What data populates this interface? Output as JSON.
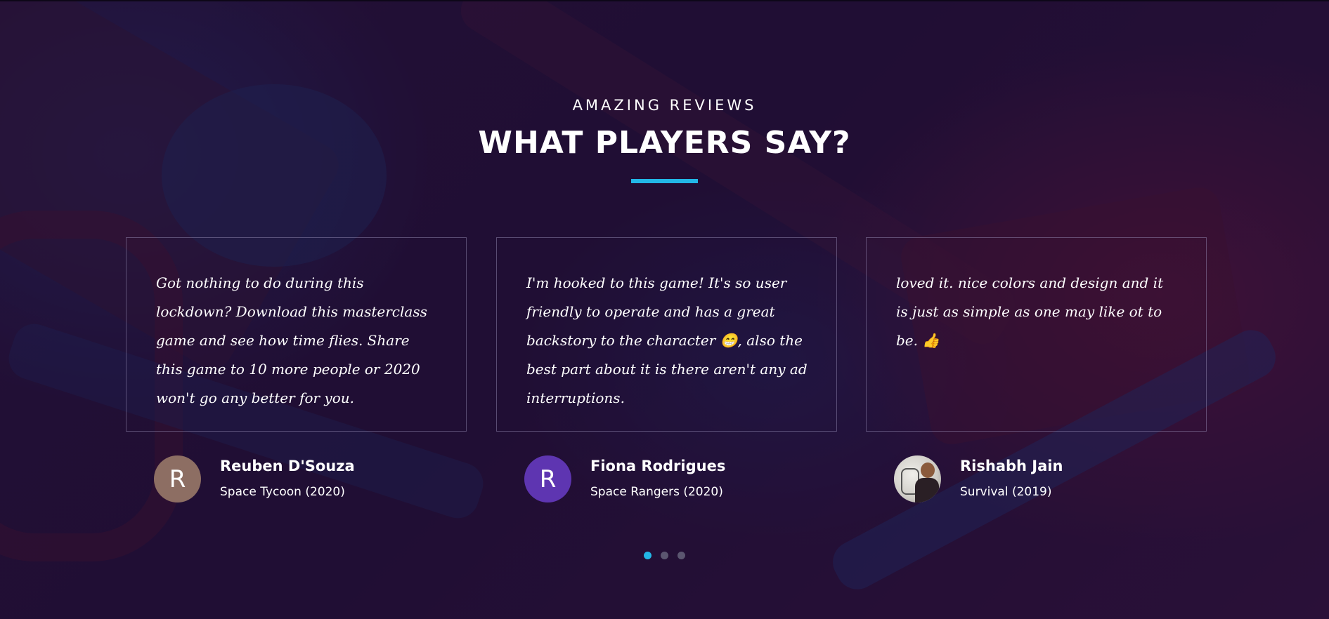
{
  "section": {
    "eyebrow": "AMAZING REVIEWS",
    "title": "WHAT PLAYERS SAY?",
    "accent_color": "#22b7e6"
  },
  "reviews": [
    {
      "quote": "Got nothing to do during this lockdown? Download this masterclass game and see how time flies. Share this game to 10 more people or 2020 won't go any better for you.",
      "name": "Reuben D'Souza",
      "game": "Space Tycoon (2020)",
      "avatar_letter": "R",
      "avatar_color": "#8d6e63"
    },
    {
      "quote": "I'm hooked to this game! It's so user friendly to operate and has a great backstory to the character 😁, also the best part about it is there aren't any ad interruptions.",
      "name": "Fiona Rodrigues",
      "game": "Space Rangers (2020)",
      "avatar_letter": "R",
      "avatar_color": "#5e35b1"
    },
    {
      "quote": "loved it. nice colors and design and it is just as simple as one may like ot to be. 👍",
      "name": "Rishabh Jain",
      "game": "Survival (2019)",
      "avatar_icon": "user-photo"
    }
  ],
  "carousel": {
    "active_index": 0,
    "dots": 3
  }
}
